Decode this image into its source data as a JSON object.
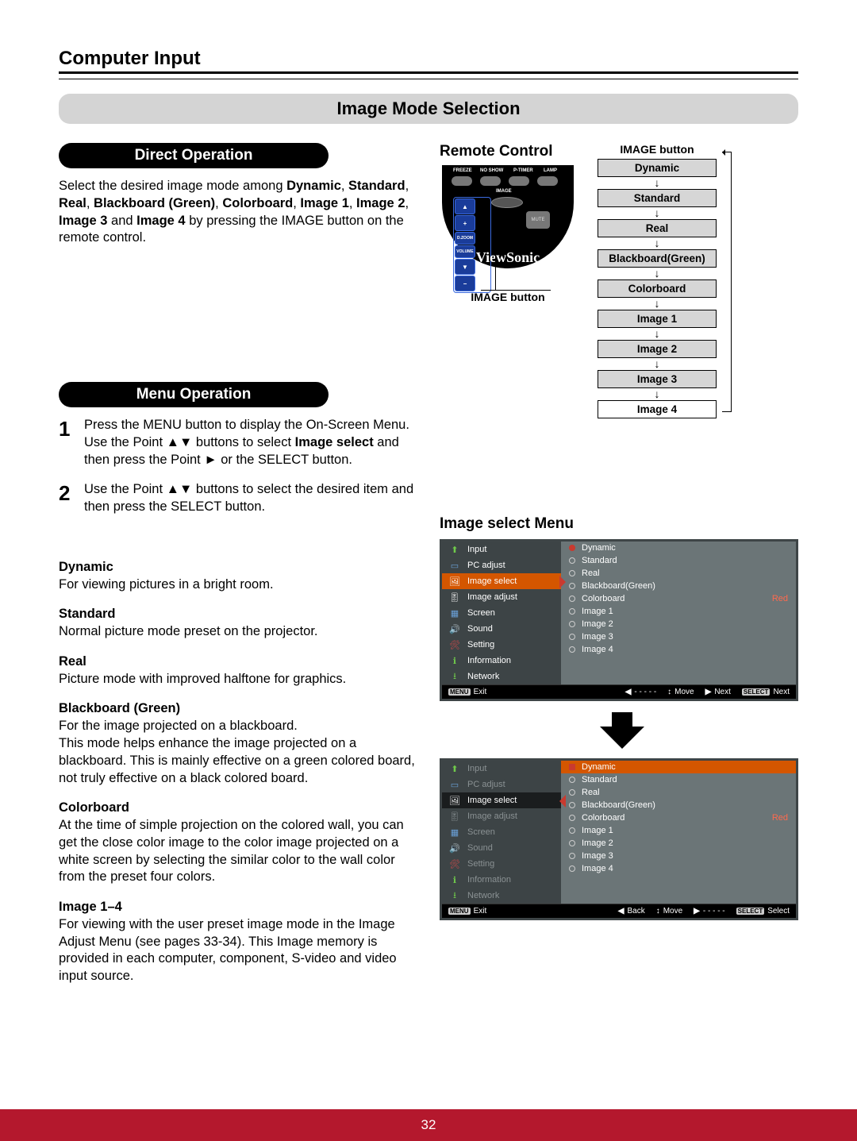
{
  "header": {
    "section": "Computer Input"
  },
  "banner": "Image Mode Selection",
  "direct": {
    "title": "Direct Operation",
    "text_pre": "Select the desired image mode among ",
    "bold_list": [
      "Dynamic",
      "Standard",
      "Real",
      "Blackboard (Green)",
      "Colorboard",
      "Image 1",
      "Image 2",
      "Image 3",
      "Image 4"
    ],
    "text_mid": " and ",
    "text_post": " by pressing the IMAGE button on the remote control."
  },
  "remote": {
    "title": "Remote Control",
    "button_label": "IMAGE button",
    "labels": [
      "FREEZE",
      "NO SHOW",
      "P-TIMER",
      "LAMP"
    ],
    "center_label": "IMAGE",
    "dz_label": "D.ZOOM",
    "vol_label": "VOLUME",
    "mute_label": "MUTE",
    "brand": "ViewSonic",
    "caption": "IMAGE button"
  },
  "flow": {
    "header": "IMAGE button",
    "items": [
      "Dynamic",
      "Standard",
      "Real",
      "Blackboard(Green)",
      "Colorboard",
      "Image 1",
      "Image 2",
      "Image 3",
      "Image 4"
    ]
  },
  "menu_op": {
    "title": "Menu Operation",
    "steps": [
      {
        "n": "1",
        "text_parts": [
          "Press the MENU button to display the On-Screen Menu. Use the Point ▲▼ buttons to select ",
          "Image select",
          " and then press the Point ► or the SELECT button."
        ]
      },
      {
        "n": "2",
        "text": "Use the Point ▲▼ buttons to select  the desired item and then press the SELECT button."
      }
    ]
  },
  "modes": [
    {
      "name": "Dynamic",
      "desc": "For viewing pictures in a bright room."
    },
    {
      "name": "Standard",
      "desc": "Normal picture mode preset on the projector."
    },
    {
      "name": "Real",
      "desc": "Picture mode with improved halftone for graphics."
    },
    {
      "name": "Blackboard (Green)",
      "desc": "For the image projected on a blackboard.\nThis mode helps enhance the image projected on a blackboard. This is mainly effective on a green colored board, not truly effective on a black colored board."
    },
    {
      "name": "Colorboard",
      "desc": "At the time of simple projection on the colored wall, you can get the close color image to the color image projected on a white screen by selecting the similar color to the wall color from the preset four colors."
    },
    {
      "name": "Image 1–4",
      "desc": "For viewing with the user preset image mode in the Image Adjust Menu (see pages 33-34). This Image memory is provided in each computer, component, S-video and video input source."
    }
  ],
  "osd": {
    "title": "Image select Menu",
    "side_items": [
      "Input",
      "PC adjust",
      "Image select",
      "Image adjust",
      "Screen",
      "Sound",
      "Setting",
      "Information",
      "Network"
    ],
    "radio_items": [
      "Dynamic",
      "Standard",
      "Real",
      "Blackboard(Green)",
      "Colorboard",
      "Image 1",
      "Image 2",
      "Image 3",
      "Image 4"
    ],
    "badge": "Red",
    "bottom1": {
      "b0": "MENU",
      "l0": "Exit",
      "b1": "◀",
      "l1": "- - - - -",
      "b2": "↕",
      "l2": "Move",
      "b3": "▶",
      "l3": "Next",
      "b4": "SELECT",
      "l4": "Next"
    },
    "bottom2": {
      "b0": "MENU",
      "l0": "Exit",
      "b1": "◀",
      "l1": "Back",
      "b2": "↕",
      "l2": "Move",
      "b3": "▶",
      "l3": "- - - - -",
      "b4": "SELECT",
      "l4": "Select"
    }
  },
  "page_number": "32"
}
